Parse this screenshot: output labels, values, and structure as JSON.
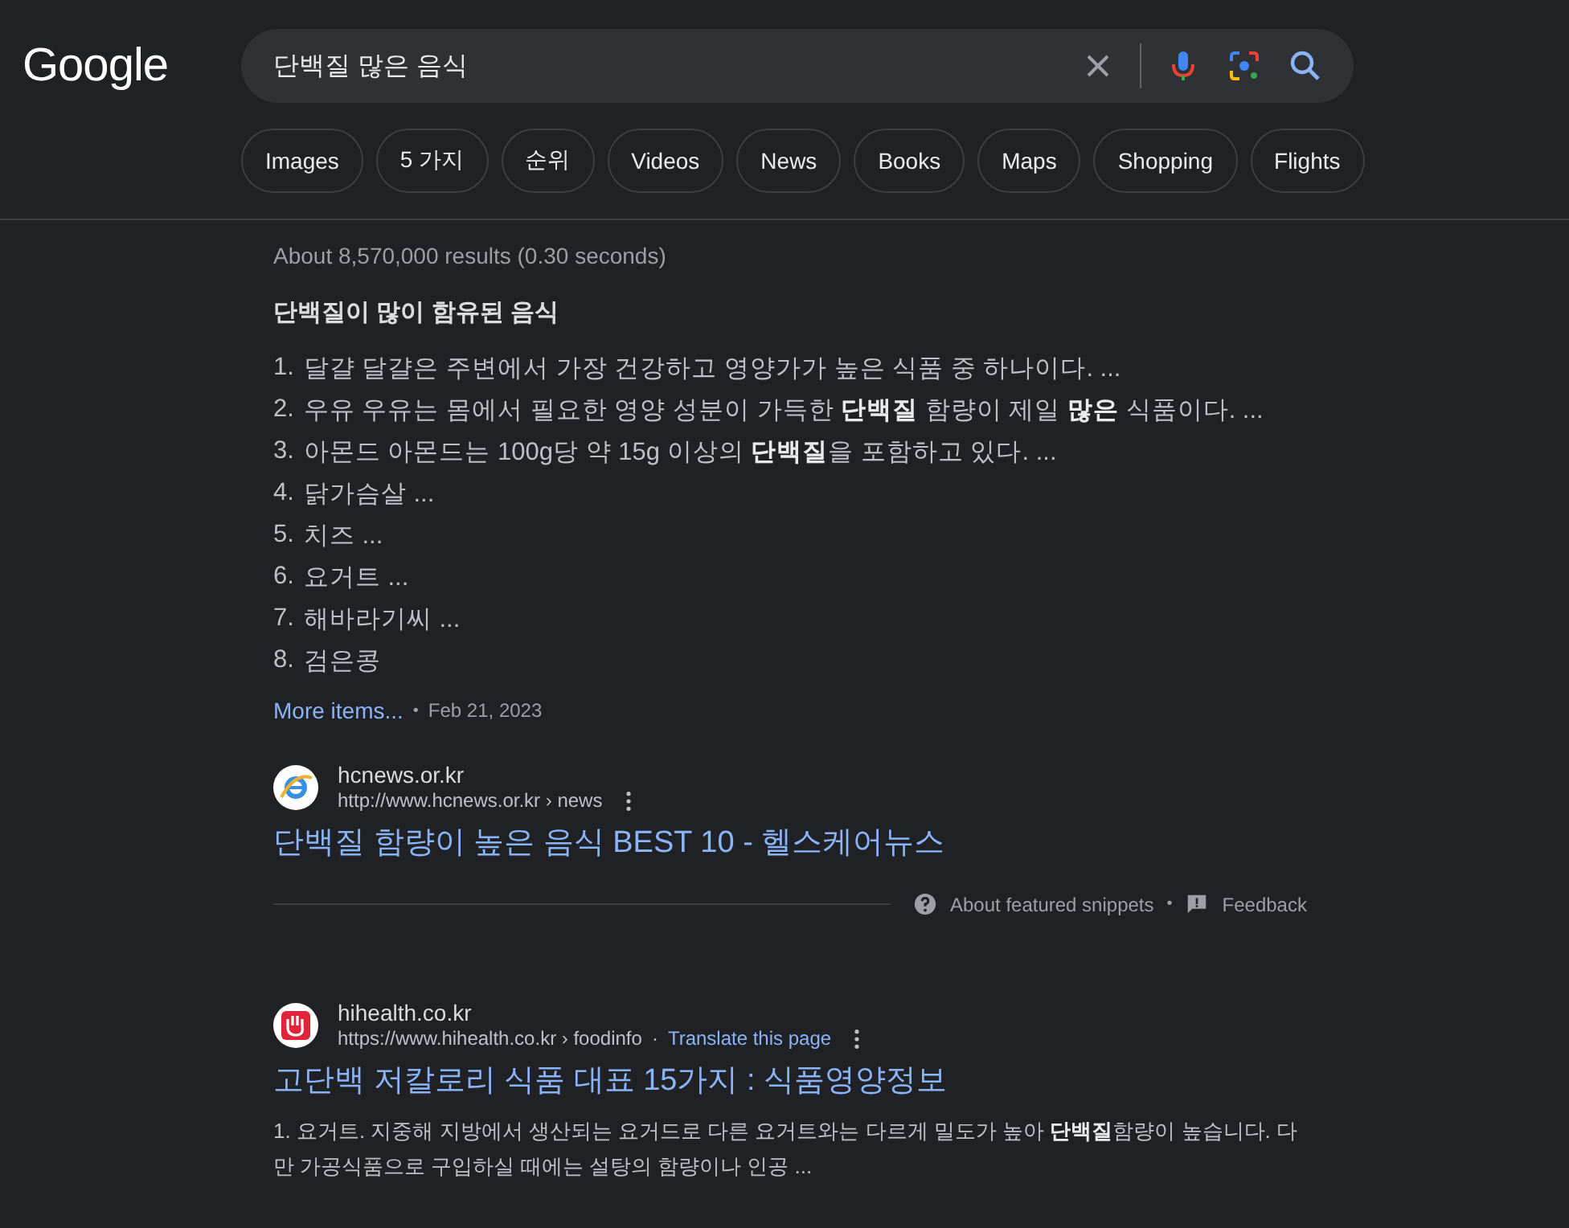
{
  "logo": "Google",
  "search": {
    "value": "단백질 많은 음식"
  },
  "chips": [
    {
      "label": "Images"
    },
    {
      "label": "5 가지"
    },
    {
      "label": "순위"
    },
    {
      "label": "Videos"
    },
    {
      "label": "News"
    },
    {
      "label": "Books"
    },
    {
      "label": "Maps"
    },
    {
      "label": "Shopping"
    },
    {
      "label": "Flights"
    }
  ],
  "result_stats": "About 8,570,000 results (0.30 seconds)",
  "featured_snippet": {
    "heading": "단백질이 많이 함유된 음식",
    "items": [
      {
        "number": "1.",
        "text": "달걀 달걀은 주변에서 가장 건강하고 영양가가 높은 식품 중 하나이다. ..."
      },
      {
        "number": "2.",
        "text": "우유 우유는 몸에서 필요한 영양 성분이 가득한 **단백질** 함량이 제일 **많은** 식품이다. ..."
      },
      {
        "number": "3.",
        "text": "아몬드 아몬드는 100g당 약 15g 이상의 **단백질**을 포함하고 있다. ..."
      },
      {
        "number": "4.",
        "text": "닭가슴살 ..."
      },
      {
        "number": "5.",
        "text": "치즈 ..."
      },
      {
        "number": "6.",
        "text": "요거트 ..."
      },
      {
        "number": "7.",
        "text": "해바라기씨 ..."
      },
      {
        "number": "8.",
        "text": "검은콩"
      }
    ],
    "more_link": "More items...",
    "date_separator": "•",
    "date": "Feb 21, 2023",
    "source": {
      "site": "hcnews.or.kr",
      "url": "http://www.hcnews.or.kr › news",
      "title": "단백질 함량이 높은 음식 BEST 10 - 헬스케어뉴스"
    },
    "about_link": "About featured snippets",
    "links_separator": "•",
    "feedback_link": "Feedback"
  },
  "results": [
    {
      "site": "hihealth.co.kr",
      "url": "https://www.hihealth.co.kr › foodinfo",
      "url_separator": "·",
      "translate": "Translate this page",
      "title": "고단백 저칼로리 식품 대표 15가지 : 식품영양정보",
      "snippet": "1. 요거트. 지중해 지방에서 생산되는 요거드로 다른 요거트와는 다르게 밀도가 높아 **단백질**함량이 높습니다. 다만 가공식품으로 구입하실 때에는 설탕의 함량이나 인공 ..."
    }
  ]
}
